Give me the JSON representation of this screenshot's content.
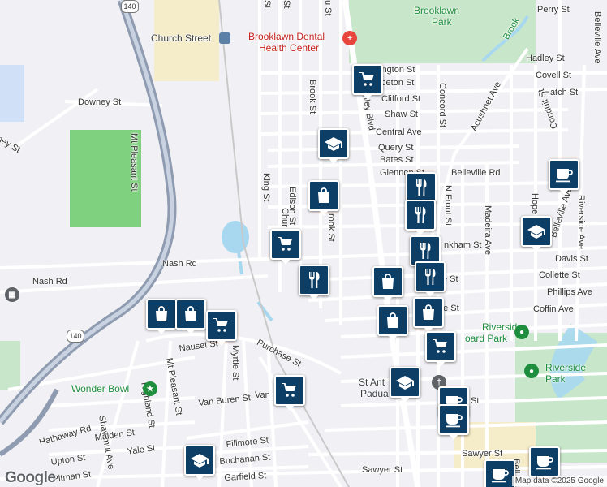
{
  "map": {
    "attribution": "Map data ©2025 Google",
    "logo": "Google",
    "colors": {
      "marker": "#0d3e66",
      "park": "#c8e6c9",
      "water": "#a7d8f0",
      "highway": "#8e9bb0",
      "road": "#ffffff",
      "land": "#f1f0f4"
    }
  },
  "streets": [
    {
      "id": "perry",
      "text": "Perry St"
    },
    {
      "id": "belleville-ave-1",
      "text": "Belleville Ave"
    },
    {
      "id": "hadley",
      "text": "Hadley St"
    },
    {
      "id": "covell",
      "text": "Covell St"
    },
    {
      "id": "hatch",
      "text": "Hatch St"
    },
    {
      "id": "arlington",
      "text": "ington St"
    },
    {
      "id": "princeton",
      "text": "ceton St"
    },
    {
      "id": "clifford",
      "text": "Clifford St"
    },
    {
      "id": "shaw",
      "text": "Shaw St"
    },
    {
      "id": "central",
      "text": "Central Ave"
    },
    {
      "id": "query",
      "text": "Query St"
    },
    {
      "id": "bates",
      "text": "Bates St"
    },
    {
      "id": "glennon",
      "text": "Glennon St"
    },
    {
      "id": "belleville-rd",
      "text": "Belleville Rd"
    },
    {
      "id": "brook-1",
      "text": "Brook St"
    },
    {
      "id": "brook-2",
      "text": "Brook"
    },
    {
      "id": "ashley",
      "text": "Ashley Blvd"
    },
    {
      "id": "concord",
      "text": "Concord St"
    },
    {
      "id": "acushnet",
      "text": "Acushnet Ave"
    },
    {
      "id": "conduit",
      "text": "Conduit St"
    },
    {
      "id": "n-front",
      "text": "N Front St"
    },
    {
      "id": "madeira",
      "text": "Madeira Ave"
    },
    {
      "id": "hope",
      "text": "Hope"
    },
    {
      "id": "belleville-ave-2",
      "text": "Belleville Ave"
    },
    {
      "id": "riverside-ave",
      "text": "Riverside Ave"
    },
    {
      "id": "deane",
      "text": "nkham St"
    },
    {
      "id": "davis",
      "text": "Davis St"
    },
    {
      "id": "collette",
      "text": "Collette St"
    },
    {
      "id": "phillips",
      "text": "Phillips Ave"
    },
    {
      "id": "coffin",
      "text": "Coffin Ave"
    },
    {
      "id": "king",
      "text": "King St"
    },
    {
      "id": "edison",
      "text": "Edison St"
    },
    {
      "id": "church",
      "text": "Chur"
    },
    {
      "id": "brook-3",
      "text": "rook St"
    },
    {
      "id": "downey",
      "text": "Downey St"
    },
    {
      "id": "ney",
      "text": "ney St"
    },
    {
      "id": "mt-pleasant-1",
      "text": "Mt Pleasant St"
    },
    {
      "id": "nash-1",
      "text": "Nash Rd"
    },
    {
      "id": "nash-2",
      "text": "Nash Rd"
    },
    {
      "id": "nauset",
      "text": "Nauset St"
    },
    {
      "id": "purchase",
      "text": "Purchase St"
    },
    {
      "id": "myrtle",
      "text": "Myrtle St"
    },
    {
      "id": "mt-pleasant-2",
      "text": "Mt Pleasant St"
    },
    {
      "id": "van-buren",
      "text": "Van Buren St"
    },
    {
      "id": "van",
      "text": "Van"
    },
    {
      "id": "hathaway",
      "text": "Hathaway Rd"
    },
    {
      "id": "shawmut",
      "text": "Shawmut Ave"
    },
    {
      "id": "highland",
      "text": "Highland St"
    },
    {
      "id": "malden",
      "text": "Malden St"
    },
    {
      "id": "yale",
      "text": "Yale St"
    },
    {
      "id": "upton",
      "text": "Upton St"
    },
    {
      "id": "pitman",
      "text": "Pitman St"
    },
    {
      "id": "fillmore",
      "text": "Fillmore St"
    },
    {
      "id": "buchanan",
      "text": "Buchanan St"
    },
    {
      "id": "garfield",
      "text": "Garfield St"
    },
    {
      "id": "sawyer-1",
      "text": "Sawyer St"
    },
    {
      "id": "sawyer-2",
      "text": "Sawyer St"
    },
    {
      "id": "bell",
      "text": "Bell"
    },
    {
      "id": "top-st",
      "text": "St"
    },
    {
      "id": "top-st2",
      "text": "St"
    },
    {
      "id": "top-u-st",
      "text": "u St"
    },
    {
      "id": "st-near-cafe",
      "text": "St"
    },
    {
      "id": "tte",
      "text": "tte St"
    },
    {
      "id": "e-st",
      "text": "e St"
    }
  ],
  "pois": {
    "church_street": "Church Street",
    "dental_1": "Brooklawn Dental",
    "dental_2": "Health Center",
    "brooklawn_park_1": "Brooklawn",
    "brooklawn_park_2": "Park",
    "wonder_bowl": "Wonder Bowl",
    "riverside_board_1": "Riverside",
    "riverside_board_2": "oard Park",
    "riverside_park": "Riverside Park",
    "st_anthony_1": "St Ant",
    "st_anthony_2": "Padua"
  },
  "shields": {
    "route140_top": "140",
    "route140_mid": "140"
  },
  "markers": [
    {
      "id": "m1",
      "icon": "cart"
    },
    {
      "id": "m2",
      "icon": "school"
    },
    {
      "id": "m3",
      "icon": "bag"
    },
    {
      "id": "m4",
      "icon": "cart"
    },
    {
      "id": "m5",
      "icon": "restaurant"
    },
    {
      "id": "m6",
      "icon": "bag"
    },
    {
      "id": "m7",
      "icon": "bag"
    },
    {
      "id": "m8",
      "icon": "cafe"
    },
    {
      "id": "m9",
      "icon": "school"
    },
    {
      "id": "m10",
      "icon": "restaurant"
    },
    {
      "id": "m11",
      "icon": "restaurant"
    },
    {
      "id": "m12",
      "icon": "restaurant"
    },
    {
      "id": "m13",
      "icon": "restaurant"
    },
    {
      "id": "m14",
      "icon": "bag"
    },
    {
      "id": "m15",
      "icon": "bag"
    },
    {
      "id": "m16",
      "icon": "bag"
    },
    {
      "id": "m17",
      "icon": "cart"
    },
    {
      "id": "m18",
      "icon": "cart"
    },
    {
      "id": "m19",
      "icon": "school"
    },
    {
      "id": "m20",
      "icon": "cart"
    },
    {
      "id": "m21",
      "icon": "cafe"
    },
    {
      "id": "m22",
      "icon": "cafe"
    },
    {
      "id": "m23",
      "icon": "school"
    },
    {
      "id": "m24",
      "icon": "cafe"
    },
    {
      "id": "m25",
      "icon": "cafe"
    }
  ]
}
